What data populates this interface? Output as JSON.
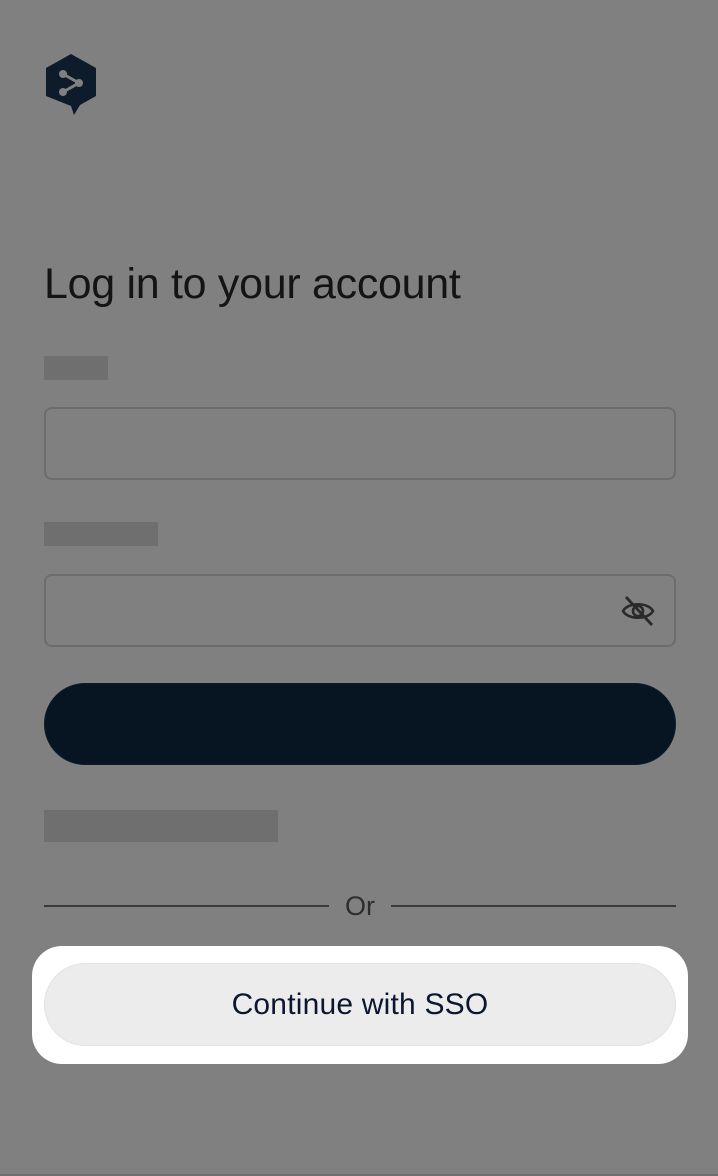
{
  "header": {
    "logo_icon": "deepl-logo-icon"
  },
  "form": {
    "title": "Log in to your account",
    "email": {
      "value": "",
      "placeholder": ""
    },
    "password": {
      "value": "",
      "placeholder": "",
      "toggle_icon": "eye-off-icon"
    },
    "login_button_label": ""
  },
  "divider": {
    "label": "Or"
  },
  "sso": {
    "button_label": "Continue with SSO"
  },
  "colors": {
    "overlay": "#808080",
    "brand_dark": "#071523",
    "sso_button_bg": "#ececec",
    "sso_text": "#0b1730",
    "highlight": "#ffffff"
  }
}
